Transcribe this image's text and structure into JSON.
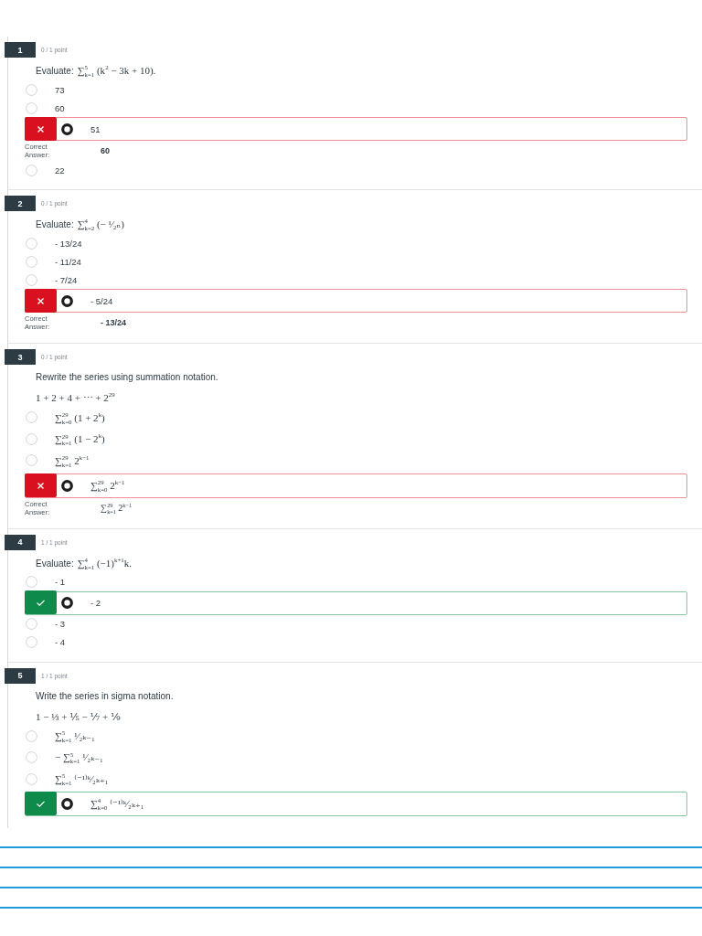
{
  "questions": [
    {
      "number": "1",
      "points": "0 / 1 point",
      "prompt": [
        {
          "kind": "text",
          "text": "Evaluate:"
        },
        {
          "kind": "math",
          "text": "∑$^{5}$$_{k=1}$ (k$^{2}$ − 3k + 10)."
        }
      ],
      "answers": [
        {
          "kind": "text",
          "text": "73",
          "selected": false
        },
        {
          "kind": "text",
          "text": "60",
          "selected": false
        },
        {
          "kind": "text",
          "text": "51",
          "selected": true
        },
        {
          "kind": "text",
          "text": "22",
          "selected": false
        }
      ],
      "is_correct": false,
      "correct_answer": {
        "label": "Correct Answer:",
        "kind": "text",
        "value": "60"
      }
    },
    {
      "number": "2",
      "points": "0 / 1 point",
      "prompt": [
        {
          "kind": "text",
          "text": "Evaluate:"
        },
        {
          "kind": "math",
          "text": "∑$^{4}$$_{k=2}$ (− ¹⁄₂ₙ)"
        }
      ],
      "answers": [
        {
          "kind": "text",
          "text": "- 13/24",
          "selected": false
        },
        {
          "kind": "text",
          "text": "- 11/24",
          "selected": false
        },
        {
          "kind": "text",
          "text": "- 7/24",
          "selected": false
        },
        {
          "kind": "text",
          "text": "- 5/24",
          "selected": true
        }
      ],
      "is_correct": false,
      "correct_answer": {
        "label": "Correct Answer:",
        "kind": "text",
        "value": "- 13/24"
      }
    },
    {
      "number": "3",
      "points": "0 / 1 point",
      "prompt": [
        {
          "kind": "text",
          "text": "Rewrite the series using summation notation."
        }
      ],
      "series": "1 + 2 + 4 + ⋯ + 2$^{29}$",
      "answers": [
        {
          "kind": "math",
          "text": "∑$^{29}$$_{k=0}$ (1 + 2$^{k}$)",
          "selected": false
        },
        {
          "kind": "math",
          "text": "∑$^{29}$$_{k=1}$ (1 − 2$^{k}$)",
          "selected": false
        },
        {
          "kind": "math",
          "text": "∑$^{29}$$_{k=1}$ 2$^{k−1}$",
          "selected": false
        },
        {
          "kind": "math",
          "text": "∑$^{29}$$_{k=0}$ 2$^{k−1}$",
          "selected": true
        }
      ],
      "is_correct": false,
      "correct_answer": {
        "label": "Correct Answer:",
        "kind": "math",
        "value": "∑$^{29}$$_{k=1}$ 2$^{k−1}$"
      }
    },
    {
      "number": "4",
      "points": "1 / 1 point",
      "prompt": [
        {
          "kind": "text",
          "text": "Evaluate:"
        },
        {
          "kind": "math",
          "text": "∑$^{4}$$_{k=1}$ (−1)$^{k+1}$k."
        }
      ],
      "answers": [
        {
          "kind": "text",
          "text": "- 1",
          "selected": false
        },
        {
          "kind": "text",
          "text": "- 2",
          "selected": true
        },
        {
          "kind": "text",
          "text": "- 3",
          "selected": false
        },
        {
          "kind": "text",
          "text": "- 4",
          "selected": false
        }
      ],
      "is_correct": true
    },
    {
      "number": "5",
      "points": "1 / 1 point",
      "prompt": [
        {
          "kind": "text",
          "text": "Write the series in sigma notation."
        }
      ],
      "series": "1 − ⅓ + ⅕ − ⅐ + ⅑",
      "answers": [
        {
          "kind": "math",
          "text": "∑$^{5}$$_{k=1}$ ¹⁄₂ₖ₋₁",
          "selected": false
        },
        {
          "kind": "math",
          "text": "− ∑$^{5}$$_{k=1}$ ¹⁄₂ₖ₋₁",
          "selected": false
        },
        {
          "kind": "math",
          "text": "∑$^{5}$$_{k=1}$ ⁽⁻¹⁾ᵏ⁄₂ₖ₊₁",
          "selected": false
        },
        {
          "kind": "math",
          "text": "∑$^{4}$$_{k=0}$ ⁽⁻¹⁾ᵏ⁄₂ₖ₊₁",
          "selected": true
        }
      ],
      "is_correct": true
    }
  ]
}
